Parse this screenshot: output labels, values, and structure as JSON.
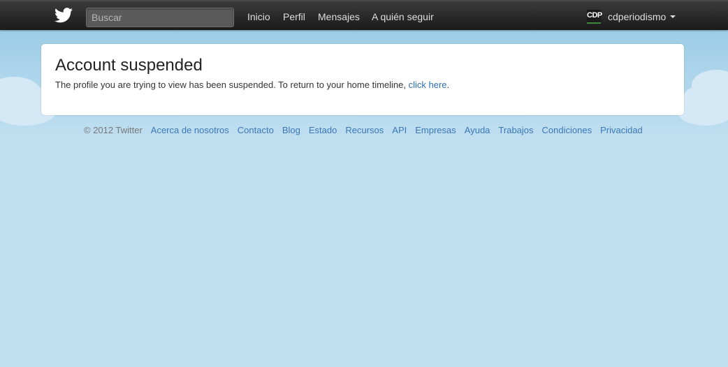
{
  "header": {
    "search": {
      "placeholder": "Buscar",
      "value": ""
    },
    "nav": [
      {
        "label": "Inicio"
      },
      {
        "label": "Perfil"
      },
      {
        "label": "Mensajes"
      },
      {
        "label": "A quién seguir"
      }
    ],
    "user": {
      "avatar_text": "CDP",
      "username": "cdperiodismo"
    }
  },
  "main": {
    "title": "Account suspended",
    "message": "The profile you are trying to view has been suspended. To return to your home timeline,",
    "link_text": "click here",
    "trailing": "."
  },
  "footer": {
    "copyright": "© 2012 Twitter",
    "links": [
      {
        "label": "Acerca de nosotros"
      },
      {
        "label": "Contacto"
      },
      {
        "label": "Blog"
      },
      {
        "label": "Estado"
      },
      {
        "label": "Recursos"
      },
      {
        "label": "API"
      },
      {
        "label": "Empresas"
      },
      {
        "label": "Ayuda"
      },
      {
        "label": "Trabajos"
      },
      {
        "label": "Condiciones"
      },
      {
        "label": "Privacidad"
      }
    ]
  },
  "colors": {
    "topbar": "#222222",
    "sky": "#c0def0",
    "link": "#2a6fb2"
  },
  "icons": [
    "twitter-bird-icon",
    "caret-down-icon"
  ]
}
